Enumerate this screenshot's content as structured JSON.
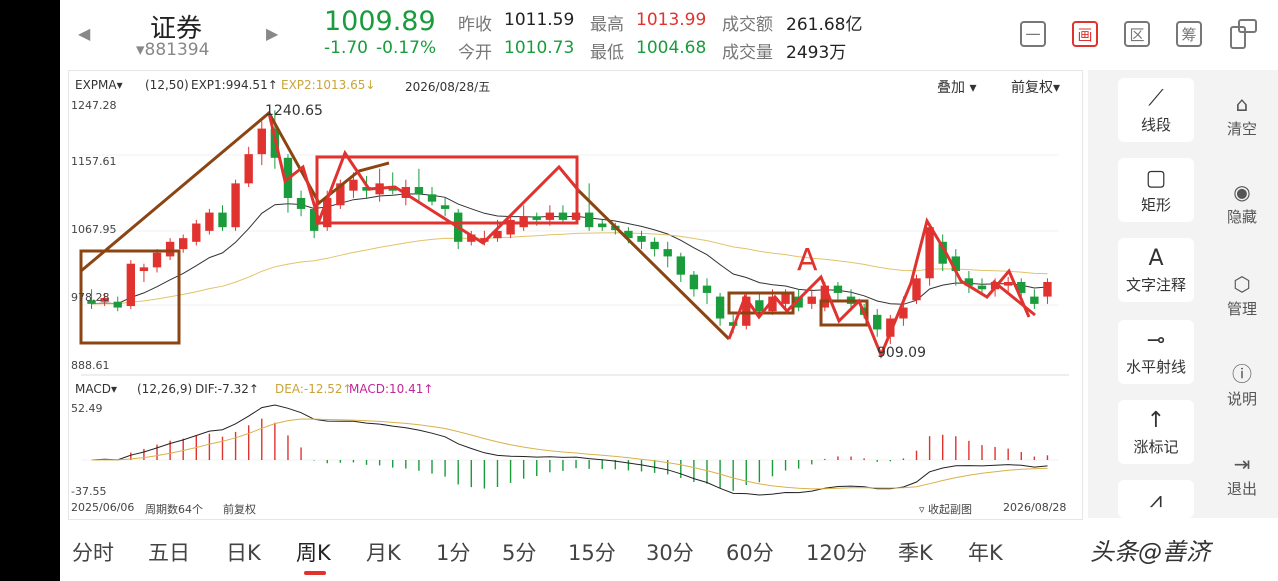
{
  "header": {
    "prev_icon": "caret-left",
    "next_icon": "caret-right",
    "name": "证券",
    "code": "▾881394",
    "price": "1009.89",
    "change": "-1.70",
    "change_pct": "-0.17%",
    "stats": {
      "prev_close_label": "昨收",
      "prev_close": "1011.59",
      "open_label": "今开",
      "open": "1010.73",
      "high_label": "最高",
      "high": "1013.99",
      "low_label": "最低",
      "low": "1004.68",
      "amount_label": "成交额",
      "amount": "261.68亿",
      "volume_label": "成交量",
      "volume": "2493万"
    },
    "tools": [
      "一",
      "画",
      "区",
      "筹"
    ],
    "colors": {
      "up": "#e0332f",
      "down": "#1a9c3c"
    }
  },
  "main_chart": {
    "indicator": "EXPMA",
    "params": "(12,50)",
    "exp1": "EXP1:994.51↑",
    "exp2": "EXP2:1013.65↓",
    "date": "2026/08/28/五",
    "overlay": "叠加",
    "adjust": "前复权",
    "y_labels": [
      "1247.28",
      "1157.61",
      "1067.95",
      "978.28",
      "888.61"
    ],
    "high_marker": "1240.65",
    "low_marker": "909.09",
    "annotation": "A"
  },
  "macd_chart": {
    "indicator": "MACD",
    "params": "(12,26,9)",
    "dif": "DIF:-7.32↑",
    "dea": "DEA:-12.52↑",
    "macd": "MACD:10.41↑",
    "y_top": "52.49",
    "y_bottom": "-37.55"
  },
  "footer_bar": {
    "start_date": "2025/06/06",
    "period_count": "周期数64个",
    "adjust": "前复权",
    "collapse": "收起副图",
    "end_date": "2026/08/28"
  },
  "chart_data": {
    "type": "candlestick",
    "ylim": [
      888.61,
      1247.28
    ],
    "candles": [
      [
        980,
        975,
        995,
        968
      ],
      [
        978,
        983,
        990,
        972
      ],
      [
        978,
        970,
        985,
        965
      ],
      [
        972,
        1030,
        1035,
        968
      ],
      [
        1020,
        1025,
        1030,
        1005
      ],
      [
        1025,
        1045,
        1050,
        1018
      ],
      [
        1040,
        1060,
        1065,
        1035
      ],
      [
        1050,
        1065,
        1070,
        1045
      ],
      [
        1060,
        1085,
        1090,
        1055
      ],
      [
        1075,
        1100,
        1105,
        1070
      ],
      [
        1100,
        1080,
        1110,
        1075
      ],
      [
        1080,
        1140,
        1145,
        1075
      ],
      [
        1140,
        1180,
        1190,
        1135
      ],
      [
        1180,
        1215,
        1225,
        1165
      ],
      [
        1215,
        1175,
        1240,
        1160
      ],
      [
        1175,
        1120,
        1180,
        1100
      ],
      [
        1120,
        1105,
        1130,
        1095
      ],
      [
        1105,
        1075,
        1115,
        1065
      ],
      [
        1080,
        1120,
        1130,
        1075
      ],
      [
        1110,
        1140,
        1145,
        1105
      ],
      [
        1130,
        1145,
        1155,
        1120
      ],
      [
        1135,
        1130,
        1150,
        1120
      ],
      [
        1125,
        1140,
        1160,
        1115
      ],
      [
        1135,
        1130,
        1155,
        1125
      ],
      [
        1120,
        1135,
        1145,
        1110
      ],
      [
        1135,
        1125,
        1160,
        1115
      ],
      [
        1125,
        1115,
        1135,
        1110
      ],
      [
        1110,
        1105,
        1120,
        1095
      ],
      [
        1100,
        1060,
        1105,
        1050
      ],
      [
        1060,
        1070,
        1075,
        1055
      ],
      [
        1060,
        1065,
        1075,
        1055
      ],
      [
        1065,
        1075,
        1090,
        1060
      ],
      [
        1070,
        1090,
        1095,
        1065
      ],
      [
        1080,
        1095,
        1110,
        1075
      ],
      [
        1095,
        1090,
        1100,
        1082
      ],
      [
        1090,
        1100,
        1110,
        1082
      ],
      [
        1100,
        1090,
        1110,
        1085
      ],
      [
        1090,
        1100,
        1115,
        1085
      ],
      [
        1100,
        1080,
        1140,
        1075
      ],
      [
        1085,
        1080,
        1090,
        1075
      ],
      [
        1082,
        1076,
        1086,
        1070
      ],
      [
        1075,
        1065,
        1080,
        1058
      ],
      [
        1068,
        1060,
        1075,
        1050
      ],
      [
        1060,
        1050,
        1066,
        1040
      ],
      [
        1050,
        1040,
        1060,
        1025
      ],
      [
        1040,
        1015,
        1045,
        1005
      ],
      [
        1015,
        995,
        1020,
        985
      ],
      [
        1000,
        990,
        1010,
        975
      ],
      [
        985,
        955,
        990,
        945
      ],
      [
        950,
        945,
        960,
        935
      ],
      [
        945,
        985,
        990,
        940
      ],
      [
        980,
        965,
        990,
        955
      ],
      [
        965,
        985,
        995,
        960
      ],
      [
        975,
        990,
        995,
        965
      ],
      [
        985,
        970,
        995,
        965
      ],
      [
        975,
        985,
        995,
        968
      ],
      [
        970,
        1000,
        1005,
        965
      ],
      [
        1000,
        990,
        1005,
        980
      ],
      [
        985,
        975,
        995,
        965
      ],
      [
        970,
        960,
        975,
        955
      ],
      [
        960,
        940,
        968,
        930
      ],
      [
        930,
        955,
        960,
        920
      ],
      [
        955,
        970,
        985,
        945
      ],
      [
        980,
        1010,
        1015,
        975
      ],
      [
        1010,
        1080,
        1085,
        1000
      ],
      [
        1060,
        1030,
        1070,
        1020
      ],
      [
        1040,
        1020,
        1050,
        1000
      ],
      [
        1010,
        1000,
        1020,
        990
      ],
      [
        1000,
        995,
        1010,
        990
      ],
      [
        995,
        1005,
        1010,
        985
      ],
      [
        1000,
        1005,
        1012,
        990
      ],
      [
        1005,
        990,
        1010,
        985
      ],
      [
        985,
        975,
        995,
        968
      ],
      [
        985,
        1005,
        1010,
        975
      ]
    ]
  }
}
